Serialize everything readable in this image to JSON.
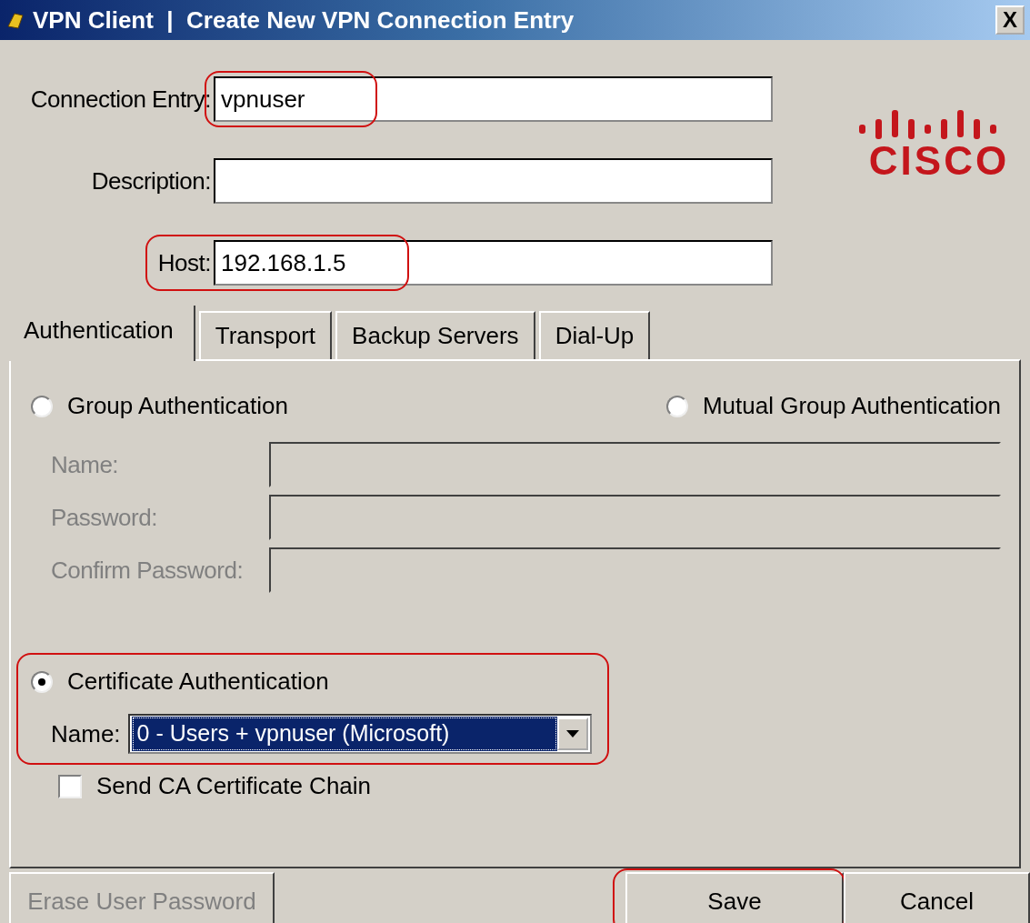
{
  "window": {
    "title": "VPN Client  |  Create New VPN Connection Entry",
    "close_label": "X"
  },
  "fields": [
    {
      "label": "Connection Entry:",
      "value": "vpnuser",
      "highlighted": true
    },
    {
      "label": "Description:",
      "highlighted": false
    },
    {
      "label": "Host:",
      "value": "192.168.1.5",
      "highlighted": true
    }
  ],
  "logo": {
    "text": "CISCO"
  },
  "tabs": [
    {
      "label": "Authentication",
      "selected": true
    },
    {
      "label": "Transport",
      "selected": false
    },
    {
      "label": "Backup Servers",
      "selected": false
    },
    {
      "label": "Dial-Up",
      "selected": false
    }
  ],
  "group_auth": {
    "label": "Group Authentication",
    "selected": false
  },
  "mutual_auth": {
    "label": "Mutual Group Authentication",
    "selected": false
  },
  "group_fields": [
    {
      "label": "Name:",
      "disabled": true
    },
    {
      "label": "Password:",
      "disabled": true
    },
    {
      "label": "Confirm Password:",
      "disabled": true
    }
  ],
  "cert_auth": {
    "label": "Certificate Authentication",
    "selected": true,
    "highlighted": true,
    "name_label": "Name:",
    "name_value": "0 - Users + vpnuser (Microsoft)"
  },
  "send_chain": {
    "label": "Send CA Certificate Chain",
    "checked": false
  },
  "buttons": [
    {
      "label": "Erase User Password",
      "disabled": true,
      "highlighted": false
    },
    {
      "label": "Save",
      "disabled": false,
      "highlighted": true
    },
    {
      "label": "Cancel",
      "disabled": false,
      "highlighted": false
    }
  ]
}
